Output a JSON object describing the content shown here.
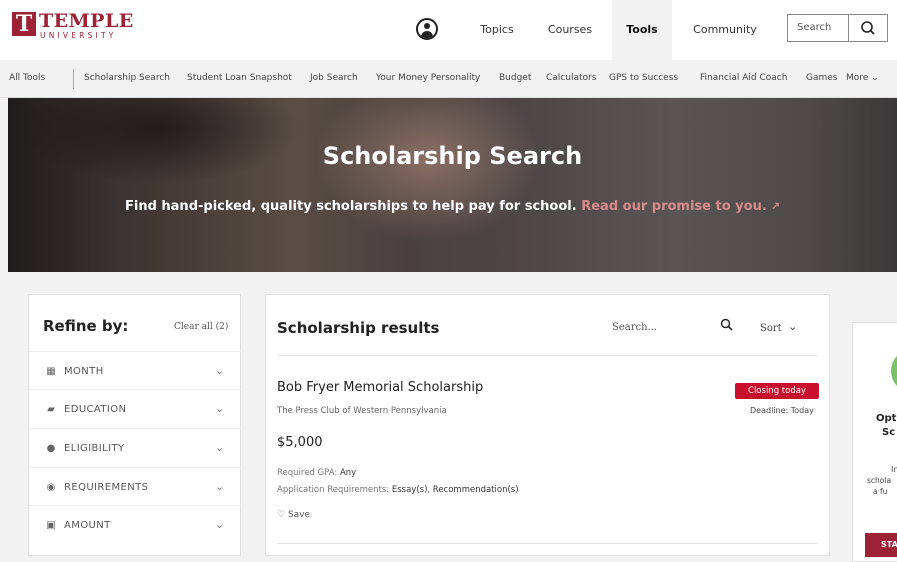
{
  "header": {
    "logo_word": "TEMPLE",
    "logo_sub": "UNIVERSITY",
    "logo_mark": "T",
    "nav": [
      "Topics",
      "Courses",
      "Tools",
      "Community"
    ],
    "active_nav": "Tools",
    "search_placeholder": "Search"
  },
  "subnav": {
    "items": [
      "All Tools",
      "Scholarship Search",
      "Student Loan Snapshot",
      "Job Search",
      "Your Money Personality",
      "Budget",
      "Calculators",
      "GPS to Success",
      "Financial Aid Coach",
      "Games",
      "More ⌄"
    ]
  },
  "hero": {
    "title": "Scholarship Search",
    "subtitle": "Find hand-picked, quality scholarships to help pay for school.",
    "promise_link": "Read our promise to you.",
    "external_icon": "external-link-icon"
  },
  "refine": {
    "title": "Refine by:",
    "clear_all": "Clear all (2)",
    "filters": [
      {
        "label": "MONTH",
        "icon": "calendar-icon"
      },
      {
        "label": "EDUCATION",
        "icon": "graduation-cap-icon"
      },
      {
        "label": "ELIGIBILITY",
        "icon": "users-icon"
      },
      {
        "label": "REQUIREMENTS",
        "icon": "check-circle-icon"
      },
      {
        "label": "AMOUNT",
        "icon": "money-icon"
      }
    ]
  },
  "results": {
    "title": "Scholarship results",
    "search_placeholder": "Search...",
    "sort_label": "Sort",
    "item": {
      "name": "Bob Fryer Memorial Scholarship",
      "org": "The Press Club of Western Pennsylvania",
      "badge": "Closing today",
      "deadline": "Deadline: Today",
      "amount": "$5,000",
      "gpa_label": "Required GPA:",
      "gpa_value": "Any",
      "app_label": "Application Requirements:",
      "app_value": "Essay(s), Recommendation(s)",
      "save_label": "Save"
    }
  },
  "side_card": {
    "line1": "Opt",
    "line2": "Sc",
    "line3": "",
    "line4": "In",
    "line5": "schola",
    "line6": "a fu",
    "button": "STA"
  },
  "colors": {
    "brand": "#9d2235",
    "badge_red": "#c8102e",
    "promise_link": "#d98a8a"
  }
}
